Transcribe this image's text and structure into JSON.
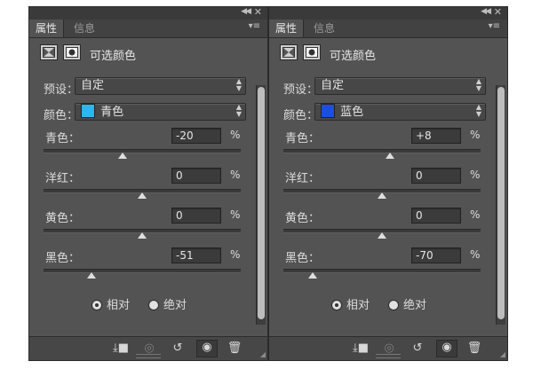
{
  "panels": [
    {
      "tabs": [
        "属性",
        "信息"
      ],
      "title": "可选颜色",
      "preset_label": "预设：",
      "preset_value": "自定",
      "color_label": "颜色：",
      "color_value": "青色",
      "color_swatch": "#2bb6f0",
      "sliders": [
        {
          "label": "青色：",
          "value": "-20",
          "unit": "%",
          "level": -20
        },
        {
          "label": "洋红：",
          "value": "0",
          "unit": "%",
          "level": 0
        },
        {
          "label": "黄色：",
          "value": "0",
          "unit": "%",
          "level": 0
        },
        {
          "label": "黑色：",
          "value": "-51",
          "unit": "%",
          "level": -51
        }
      ],
      "method_relative": "相对",
      "method_absolute": "绝对",
      "method_selected": "relative"
    },
    {
      "tabs": [
        "属性",
        "信息"
      ],
      "title": "可选颜色",
      "preset_label": "预设：",
      "preset_value": "自定",
      "color_label": "颜色：",
      "color_value": "蓝色",
      "color_swatch": "#1c4fe0",
      "sliders": [
        {
          "label": "青色：",
          "value": "+8",
          "unit": "%",
          "level": 8
        },
        {
          "label": "洋红：",
          "value": "0",
          "unit": "%",
          "level": 0
        },
        {
          "label": "黄色：",
          "value": "0",
          "unit": "%",
          "level": 0
        },
        {
          "label": "黑色：",
          "value": "-70",
          "unit": "%",
          "level": -70
        }
      ],
      "method_relative": "相对",
      "method_absolute": "绝对",
      "method_selected": "relative"
    }
  ],
  "footer_icons": [
    "clip-to-layer-icon",
    "view-previous-state-icon",
    "reset-icon",
    "visibility-eye-icon",
    "trash-icon"
  ],
  "colors": {
    "panel_bg": "#535353",
    "tab_bar": "#424242",
    "input_bg": "#3b3b3b"
  }
}
